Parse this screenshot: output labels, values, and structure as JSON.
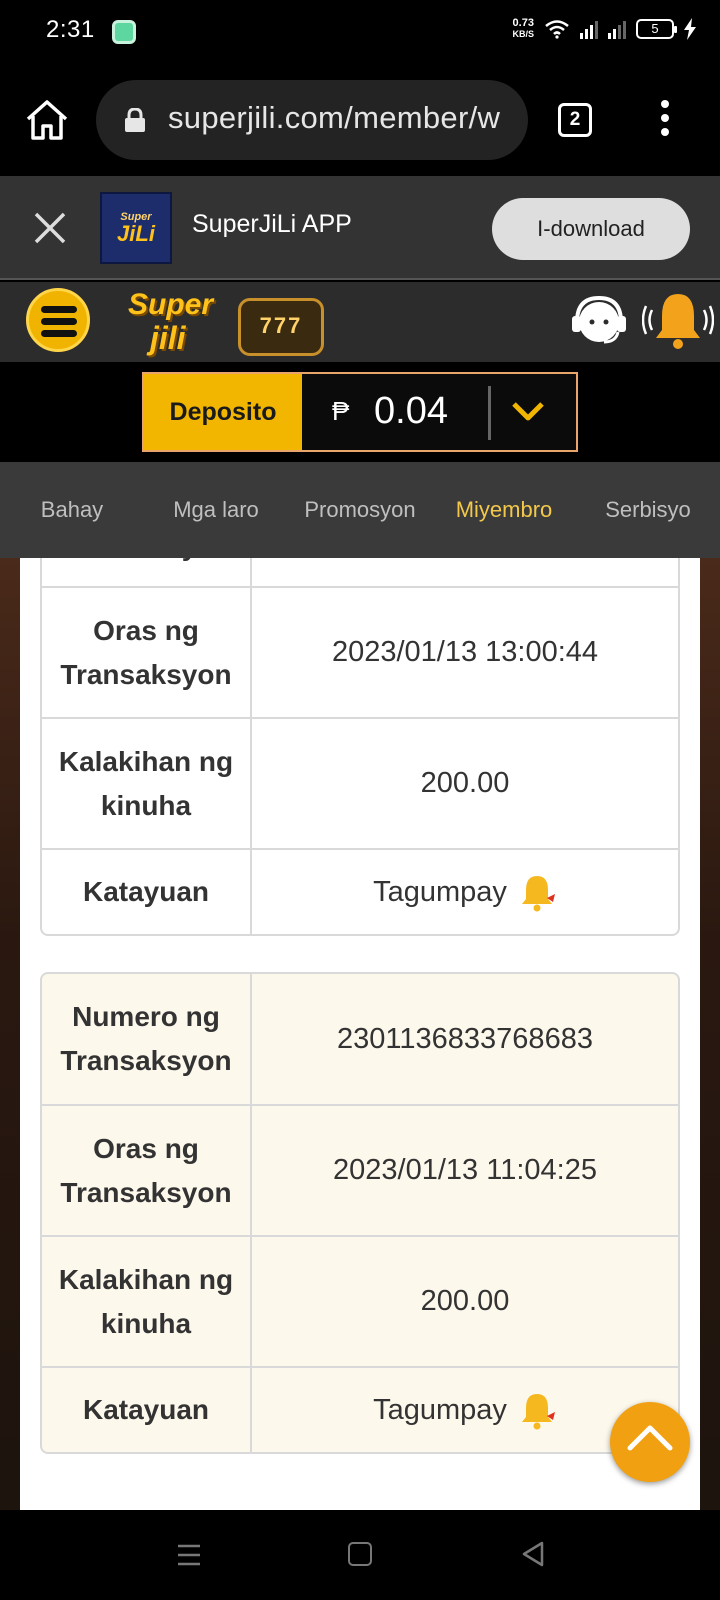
{
  "status_bar": {
    "time": "2:31",
    "net_speed": "0.73",
    "net_unit": "KB/S",
    "battery": "5"
  },
  "browser": {
    "url": "superjili.com/member/w",
    "tab_count": "2"
  },
  "app_banner": {
    "title": "SuperJiLi APP",
    "download_label": "I-download",
    "logo_top": "Super",
    "logo_bottom": "JiLi"
  },
  "site_header": {
    "logo_line1": "Super",
    "logo_line2": "jili",
    "slot_text": "777"
  },
  "deposit": {
    "label": "Deposito",
    "currency": "₱",
    "balance": "0.04"
  },
  "nav": {
    "items": [
      {
        "label": "Bahay"
      },
      {
        "label": "Mga laro"
      },
      {
        "label": "Promosyon"
      },
      {
        "label": "Miyembro"
      },
      {
        "label": "Serbisyo"
      }
    ]
  },
  "transactions": [
    {
      "time_label": "Oras ng Transaksyon",
      "time": "2023/01/13 13:00:44",
      "amount_label": "Kalakihan ng kinuha",
      "amount": "200.00",
      "status_label": "Katayuan",
      "status": "Tagumpay"
    },
    {
      "number_label": "Numero ng Transaksyon",
      "number": "2301136833768683",
      "time_label": "Oras ng Transaksyon",
      "time": "2023/01/13 11:04:25",
      "amount_label": "Kalakihan ng kinuha",
      "amount": "200.00",
      "status_label": "Katayuan",
      "status": "Tagumpay"
    }
  ],
  "partial_label": "Transaksyon",
  "colors": {
    "accent": "#f2b600",
    "active_nav": "#f3c84a",
    "scroll_btn": "#f0a010"
  }
}
